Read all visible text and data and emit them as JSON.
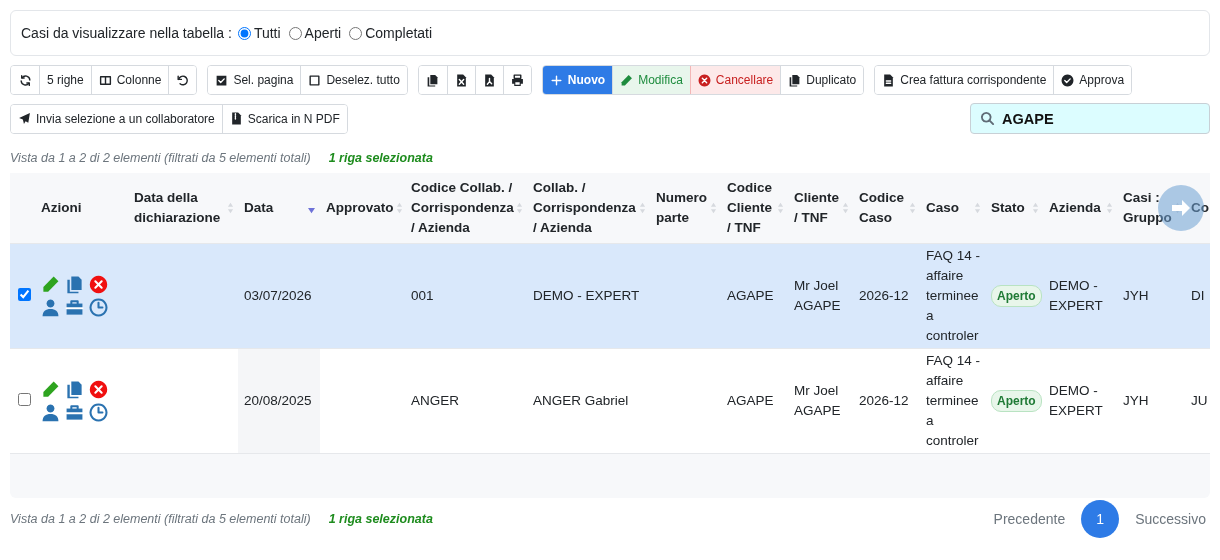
{
  "filter": {
    "label": "Casi da visualizzare nella tabella :",
    "options": [
      {
        "label": "Tutti",
        "selected": true
      },
      {
        "label": "Aperti",
        "selected": false
      },
      {
        "label": "Completati",
        "selected": false
      }
    ]
  },
  "toolbar": [
    [
      [
        {
          "kind": "icon"
        },
        {
          "kind": "text",
          "label": "5 righe"
        },
        {
          "kind": "text",
          "label": "Colonne"
        },
        {
          "kind": "icon"
        }
      ],
      [
        {
          "kind": "text",
          "label": "Sel. pagina"
        },
        {
          "kind": "text",
          "label": "Deselez. tutto"
        }
      ],
      [
        {
          "kind": "icon"
        },
        {
          "kind": "icon"
        },
        {
          "kind": "icon"
        },
        {
          "kind": "icon"
        }
      ],
      [
        {
          "kind": "text",
          "label": "Nuovo"
        },
        {
          "kind": "text",
          "label": "Modifica"
        },
        {
          "kind": "text",
          "label": "Cancellare"
        },
        {
          "kind": "text",
          "label": "Duplicato"
        }
      ],
      [
        {
          "kind": "text",
          "label": "Crea fattura corrispondente"
        },
        {
          "kind": "text",
          "label": "Approva"
        }
      ]
    ],
    [
      [
        {
          "kind": "text",
          "label": "Invia selezione a un collaboratore"
        },
        {
          "kind": "text",
          "label": "Scarica in N PDF"
        }
      ]
    ]
  ],
  "search": {
    "value": "AGAPE"
  },
  "info_top": {
    "text": "Vista da 1 a 2 di 2 elementi (filtrati da 5 elementi totali)",
    "selection": "1 riga selezionata"
  },
  "table": {
    "columns": [
      {
        "label": "Azioni",
        "kind": "actions"
      },
      {
        "label": "Data della dichiarazione",
        "kind": "text",
        "sorted": false
      },
      {
        "label": "Data",
        "kind": "text",
        "sorted": true
      },
      {
        "label": "Approvato",
        "kind": "text",
        "sorted": false
      },
      {
        "label": "Codice Collab. / Corrispondenza / Azienda",
        "kind": "text",
        "sorted": false
      },
      {
        "label": "Collab. / Corrispondenza / Azienda",
        "kind": "text",
        "sorted": false
      },
      {
        "label": "Numero parte",
        "kind": "text",
        "sorted": false
      },
      {
        "label": "Codice Cliente / TNF",
        "kind": "text",
        "sorted": false
      },
      {
        "label": "Cliente / TNF",
        "kind": "text",
        "sorted": false
      },
      {
        "label": "Codice Caso",
        "kind": "text",
        "sorted": false
      },
      {
        "label": "Caso",
        "kind": "text",
        "sorted": false
      },
      {
        "label": "Stato",
        "kind": "badge",
        "sorted": false
      },
      {
        "label": "Azienda",
        "kind": "text",
        "sorted": false
      },
      {
        "label": "Casi : Gruppo",
        "kind": "text",
        "sorted": false
      },
      {
        "label": "Co",
        "kind": "text"
      }
    ],
    "rows": [
      {
        "selected": true,
        "cells": [
          null,
          null,
          "03/07/2026",
          null,
          "001",
          "DEMO - EXPERT",
          null,
          "AGAPE",
          "Mr Joel AGAPE",
          "2026-12",
          "FAQ 14 - affaire terminee a controler",
          "Aperto",
          "DEMO - EXPERT",
          "JYH",
          "DI"
        ]
      },
      {
        "selected": false,
        "cells": [
          null,
          null,
          "20/08/2025",
          null,
          "ANGER",
          "ANGER Gabriel",
          null,
          "AGAPE",
          "Mr Joel AGAPE",
          "2026-12",
          "FAQ 14 - affaire terminee a controler",
          "Aperto",
          "DEMO - EXPERT",
          "JYH",
          "JU"
        ]
      }
    ]
  },
  "info_bottom": {
    "text": "Vista da 1 a 2 di 2 elementi (filtrati da 5 elementi totali)",
    "selection": "1 riga selezionata"
  },
  "pagination": {
    "previous": "Precedente",
    "pages": [
      {
        "label": "1",
        "selected": true
      }
    ],
    "next": "Successivo"
  }
}
